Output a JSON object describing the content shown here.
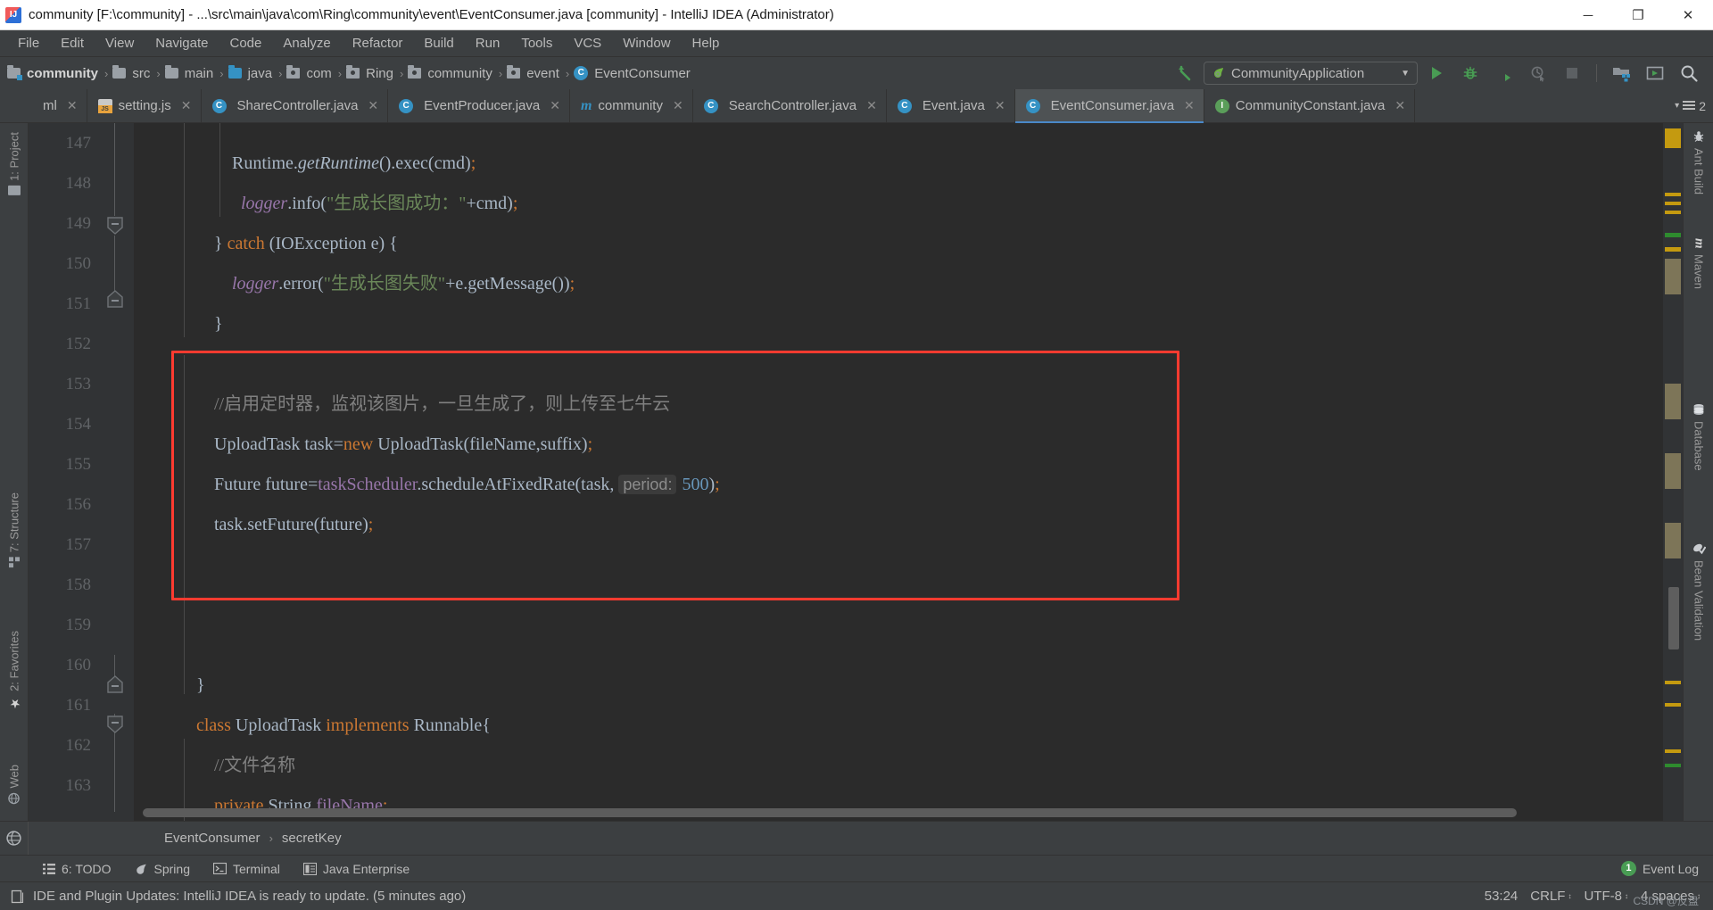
{
  "window": {
    "title": "community [F:\\community] - ...\\src\\main\\java\\com\\Ring\\community\\event\\EventConsumer.java [community] - IntelliJ IDEA (Administrator)",
    "minimize_label": "─",
    "maximize_label": "❐",
    "close_label": "✕",
    "app_icon": "intellij-idea-icon"
  },
  "menubar": {
    "items": [
      {
        "label": "File"
      },
      {
        "label": "Edit"
      },
      {
        "label": "View"
      },
      {
        "label": "Navigate"
      },
      {
        "label": "Code"
      },
      {
        "label": "Analyze"
      },
      {
        "label": "Refactor"
      },
      {
        "label": "Build"
      },
      {
        "label": "Run"
      },
      {
        "label": "Tools"
      },
      {
        "label": "VCS"
      },
      {
        "label": "Window"
      },
      {
        "label": "Help"
      }
    ]
  },
  "navbar": {
    "breadcrumbs": [
      {
        "label": "community",
        "icon": "project-folder-icon",
        "bold": true
      },
      {
        "label": "src",
        "icon": "folder-icon",
        "bold": false
      },
      {
        "label": "main",
        "icon": "folder-icon",
        "bold": false
      },
      {
        "label": "java",
        "icon": "source-root-folder-icon",
        "bold": false
      },
      {
        "label": "com",
        "icon": "package-icon",
        "bold": false
      },
      {
        "label": "Ring",
        "icon": "package-icon",
        "bold": false
      },
      {
        "label": "community",
        "icon": "package-icon",
        "bold": false
      },
      {
        "label": "event",
        "icon": "package-icon",
        "bold": false
      },
      {
        "label": "EventConsumer",
        "icon": "java-class-icon",
        "bold": false
      }
    ],
    "separator": "›",
    "run_config": {
      "name": "CommunityApplication",
      "icon": "spring-boot-icon",
      "dropdown_arrow": "▼"
    },
    "buttons": [
      {
        "name": "run-button",
        "icon": "play-icon"
      },
      {
        "name": "debug-button",
        "icon": "bug-icon"
      },
      {
        "name": "run-with-coverage-button",
        "icon": "coverage-icon"
      },
      {
        "name": "profile-button",
        "icon": "profiler-icon"
      },
      {
        "name": "stop-button",
        "icon": "stop-icon"
      },
      {
        "name": "project-structure-button",
        "icon": "project-structure-icon"
      },
      {
        "name": "update-app-button",
        "icon": "update-running-app-icon"
      },
      {
        "name": "search-everywhere-button",
        "icon": "search-icon"
      }
    ],
    "back_arrow_icon": "back-arrow-icon"
  },
  "tabs": {
    "items": [
      {
        "label": "ml",
        "icon": "xml-icon",
        "active": false,
        "truncated": true
      },
      {
        "label": "setting.js",
        "icon": "javascript-icon",
        "active": false
      },
      {
        "label": "ShareController.java",
        "icon": "java-class-icon",
        "active": false
      },
      {
        "label": "EventProducer.java",
        "icon": "java-class-icon",
        "active": false
      },
      {
        "label": "community",
        "icon": "maven-module-icon",
        "active": false
      },
      {
        "label": "SearchController.java",
        "icon": "java-class-icon",
        "active": false
      },
      {
        "label": "Event.java",
        "icon": "java-class-icon",
        "active": false
      },
      {
        "label": "EventConsumer.java",
        "icon": "java-class-icon",
        "active": true
      },
      {
        "label": "CommunityConstant.java",
        "icon": "java-interface-icon",
        "active": false
      }
    ],
    "close_glyph": "✕",
    "overflow_count": "2",
    "overflow_arrow": "▾"
  },
  "sidebar_left": {
    "items": [
      {
        "label": "1: Project",
        "icon": "project-tool-window-icon",
        "shortcut": "1"
      },
      {
        "label": "7: Structure",
        "icon": "structure-tool-window-icon",
        "shortcut": "7"
      },
      {
        "label": "2: Favorites",
        "icon": "favorites-star-icon",
        "shortcut": "2"
      },
      {
        "label": "Web",
        "icon": "web-globe-icon",
        "shortcut": ""
      }
    ]
  },
  "sidebar_right": {
    "items": [
      {
        "label": "Ant Build",
        "icon": "ant-build-icon"
      },
      {
        "label": "Maven",
        "icon": "maven-icon"
      },
      {
        "label": "Database",
        "icon": "database-icon"
      },
      {
        "label": "Bean Validation",
        "icon": "bean-validation-icon"
      }
    ]
  },
  "editor": {
    "first_line_number": 147,
    "lines": [
      {
        "n": 147,
        "fold": null,
        "tokens": [
          {
            "t": "            Runtime.",
            "c": "def"
          },
          {
            "t": "getRuntime",
            "c": "meth ital"
          },
          {
            "t": "().exec(cmd)",
            "c": "def"
          },
          {
            "t": ";",
            "c": "semi"
          }
        ]
      },
      {
        "n": 148,
        "fold": null,
        "tokens": [
          {
            "t": "              ",
            "c": "def"
          },
          {
            "t": "logger",
            "c": "fld"
          },
          {
            "t": ".info(",
            "c": "def"
          },
          {
            "t": "\"生成长图成功：\"",
            "c": "str"
          },
          {
            "t": "+cmd)",
            "c": "def"
          },
          {
            "t": ";",
            "c": "semi"
          }
        ]
      },
      {
        "n": 149,
        "fold": "minus",
        "tokens": [
          {
            "t": "        } ",
            "c": "def"
          },
          {
            "t": "catch",
            "c": "kw"
          },
          {
            "t": " (IOException e) {",
            "c": "def"
          }
        ]
      },
      {
        "n": 150,
        "fold": null,
        "tokens": [
          {
            "t": "            ",
            "c": "def"
          },
          {
            "t": "logger",
            "c": "fld"
          },
          {
            "t": ".error(",
            "c": "def"
          },
          {
            "t": "\"生成长图失败\"",
            "c": "str"
          },
          {
            "t": "+e.getMessage())",
            "c": "def"
          },
          {
            "t": ";",
            "c": "semi"
          }
        ]
      },
      {
        "n": 151,
        "fold": "end",
        "tokens": [
          {
            "t": "        }",
            "c": "def"
          }
        ]
      },
      {
        "n": 152,
        "fold": null,
        "tokens": []
      },
      {
        "n": 153,
        "fold": null,
        "tokens": [
          {
            "t": "        //启用定时器，监视该图片，一旦生成了，则上传至七牛云",
            "c": "cmt"
          }
        ]
      },
      {
        "n": 154,
        "fold": null,
        "tokens": [
          {
            "t": "        UploadTask task=",
            "c": "def"
          },
          {
            "t": "new",
            "c": "kw"
          },
          {
            "t": " UploadTask(fileName,suffix)",
            "c": "def"
          },
          {
            "t": ";",
            "c": "semi"
          }
        ]
      },
      {
        "n": 155,
        "fold": null,
        "hint": {
          "label": "period:",
          "value": "500"
        },
        "tokens": [
          {
            "t": "        Future future=",
            "c": "def"
          },
          {
            "t": "taskScheduler",
            "c": "fld2"
          },
          {
            "t": ".scheduleAtFixedRate(task, ",
            "c": "def"
          }
        ]
      },
      {
        "n": 156,
        "fold": null,
        "tokens": [
          {
            "t": "        task.setFuture(future)",
            "c": "def"
          },
          {
            "t": ";",
            "c": "semi"
          }
        ]
      },
      {
        "n": 157,
        "fold": null,
        "tokens": []
      },
      {
        "n": 158,
        "fold": null,
        "tokens": []
      },
      {
        "n": 159,
        "fold": null,
        "tokens": []
      },
      {
        "n": 160,
        "fold": "end",
        "tokens": [
          {
            "t": "    }",
            "c": "def"
          }
        ]
      },
      {
        "n": 161,
        "fold": "minus",
        "tokens": [
          {
            "t": "    ",
            "c": "def"
          },
          {
            "t": "class",
            "c": "kw"
          },
          {
            "t": " UploadTask ",
            "c": "def"
          },
          {
            "t": "implements",
            "c": "kw"
          },
          {
            "t": " Runnable{",
            "c": "def"
          }
        ]
      },
      {
        "n": 162,
        "fold": null,
        "tokens": [
          {
            "t": "        //文件名称",
            "c": "cmt"
          }
        ]
      },
      {
        "n": 163,
        "fold": null,
        "tokens": [
          {
            "t": "        ",
            "c": "def"
          },
          {
            "t": "private",
            "c": "kw"
          },
          {
            "t": " String ",
            "c": "def"
          },
          {
            "t": "fileName",
            "c": "fld2"
          },
          {
            "t": ";",
            "c": "semi"
          }
        ]
      }
    ],
    "highlight_box_color": "#ff3b30",
    "background_color": "#2b2b2b",
    "gutter_color": "#313335"
  },
  "structure_breadcrumb": {
    "globe_icon": "web-globe-icon",
    "items": [
      "EventConsumer",
      "secretKey"
    ],
    "separator": "›"
  },
  "tool_windows": {
    "items": [
      {
        "label": "6: TODO",
        "icon": "todo-list-icon",
        "shortcut": "6"
      },
      {
        "label": "Spring",
        "icon": "spring-leaf-icon",
        "shortcut": ""
      },
      {
        "label": "Terminal",
        "icon": "terminal-icon",
        "shortcut": ""
      },
      {
        "label": "Java Enterprise",
        "icon": "java-enterprise-icon",
        "shortcut": ""
      }
    ],
    "event_log": {
      "label": "Event Log",
      "count": "1"
    }
  },
  "statusbar": {
    "message": "IDE and Plugin Updates: IntelliJ IDEA is ready to update. (5 minutes ago)",
    "message_icon": "notification-icon",
    "caret_position": "53:24",
    "line_separator": "CRLF",
    "encoding": "UTF-8",
    "indent": "4 spaces",
    "stepper_glyph": "↕"
  },
  "watermark": {
    "text": "CSDN @反盘"
  },
  "colors": {
    "accent": "#4a88c7",
    "panel": "#3c3f41",
    "editor_bg": "#2b2b2b",
    "gutter_bg": "#313335",
    "text": "#bbbbbb",
    "keyword": "#cc7832",
    "string": "#6a8759",
    "field": "#9876aa",
    "comment": "#808080",
    "number": "#6897bb",
    "highlight": "#ff3b30",
    "green": "#499c54"
  }
}
